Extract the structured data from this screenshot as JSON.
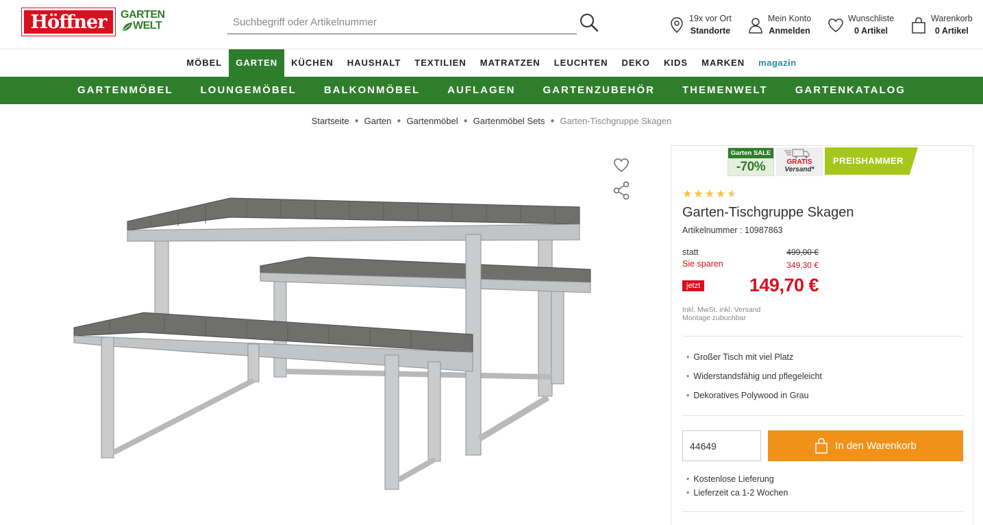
{
  "header": {
    "logo_brand": "Höffner",
    "logo_sub_line1": "GARTEN",
    "logo_sub_line2": "WELT",
    "search_placeholder": "Suchbegriff oder Artikelnummer",
    "stores": {
      "line1": "19x vor Ort",
      "line2": "Standorte",
      "icon": "location-pin-icon"
    },
    "account": {
      "line1": "Mein Konto",
      "line2": "Anmelden",
      "icon": "user-icon"
    },
    "wishlist": {
      "line1": "Wunschliste",
      "line2": "0 Artikel",
      "icon": "heart-icon"
    },
    "cart": {
      "line1": "Warenkorb",
      "line2": "0 Artikel",
      "icon": "shopping-bag-icon"
    }
  },
  "main_nav": [
    {
      "label": "MÖBEL"
    },
    {
      "label": "GARTEN",
      "active": true
    },
    {
      "label": "KÜCHEN"
    },
    {
      "label": "HAUSHALT"
    },
    {
      "label": "TEXTILIEN"
    },
    {
      "label": "MATRATZEN"
    },
    {
      "label": "LEUCHTEN"
    },
    {
      "label": "DEKO"
    },
    {
      "label": "KIDS"
    },
    {
      "label": "MARKEN"
    },
    {
      "label": "magazin"
    }
  ],
  "garden_nav": [
    {
      "label": "GARTENMÖBEL"
    },
    {
      "label": "LOUNGEMÖBEL"
    },
    {
      "label": "BALKONMÖBEL"
    },
    {
      "label": "AUFLAGEN"
    },
    {
      "label": "GARTENZUBEHÖR"
    },
    {
      "label": "THEMENWELT"
    },
    {
      "label": "GARTENKATALOG"
    }
  ],
  "breadcrumb": [
    "Startseite",
    "Garten",
    "Gartenmöbel",
    "Gartenmöbel Sets",
    "Garten-Tischgruppe Skagen"
  ],
  "badges": {
    "sale_top": "Garten SALE",
    "sale_pct": "-70%",
    "gratis_l1": "GRATIS",
    "gratis_l2": "Versand*",
    "preishammer": "PREISHAMMER"
  },
  "product": {
    "rating": 4.5,
    "title": "Garten-Tischgruppe Skagen",
    "artnr": "Artikelnummer : 10987863",
    "statt_label": "statt",
    "statt_value": "499,00 €",
    "spar_label": "Sie sparen",
    "spar_value": "349,30 €",
    "jetzt_label": "jetzt",
    "price": "149,70 €",
    "tax_line1": "Inkl. MwSt. inkl. Versand",
    "tax_line2": "Montage zubuchbar",
    "features": [
      "Großer Tisch mit viel Platz",
      "Widerstandsfähig und pflegeleicht",
      "Dekoratives Polywood in Grau"
    ],
    "quantity_value": "44649",
    "cart_button": "In den Warenkorb",
    "delivery": [
      "Kostenlose Lieferung",
      "Lieferzeit ca 1-2 Wochen"
    ]
  },
  "colors": {
    "brand_red": "#d9101e",
    "garden_green": "#2f7e2b",
    "cart_orange": "#f0921a",
    "preishammer_lime": "#a6c71a",
    "star_yellow": "#f5c342"
  }
}
